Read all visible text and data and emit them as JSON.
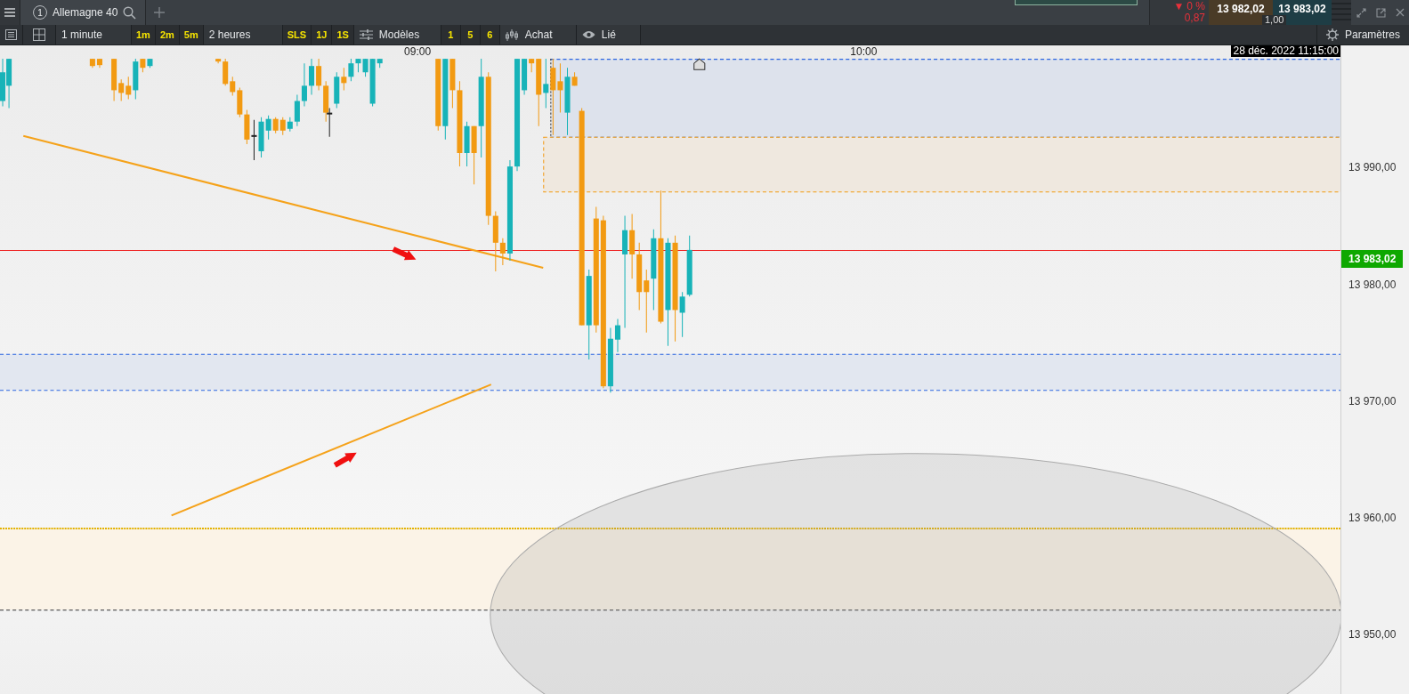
{
  "topbar": {
    "instrument": {
      "number": "1",
      "name": "Allemagne 40"
    },
    "change": {
      "arrow": "▼",
      "percent": "0 %",
      "value": "0,87"
    },
    "bid": "13 982,02",
    "ask": "13 983,02",
    "spread": "1,00"
  },
  "toolbar": {
    "interval": "1 minute",
    "intervals": [
      "1m",
      "2m",
      "5m"
    ],
    "period": "2 heures",
    "periods": [
      "SLS",
      "1J",
      "1S"
    ],
    "templates": "Modèles",
    "layouts": [
      "1",
      "5",
      "6"
    ],
    "order": "Achat",
    "link": "Lié",
    "settings": "Paramètres"
  },
  "chart": {
    "time_labels": [
      "09:00",
      "10:00"
    ],
    "cursor_time": "28 déc. 2022 11:15:00",
    "price_labels": [
      "13 990,00",
      "13 980,00",
      "13 970,00",
      "13 960,00",
      "13 950,00"
    ],
    "last_price": "13 983,02"
  }
}
